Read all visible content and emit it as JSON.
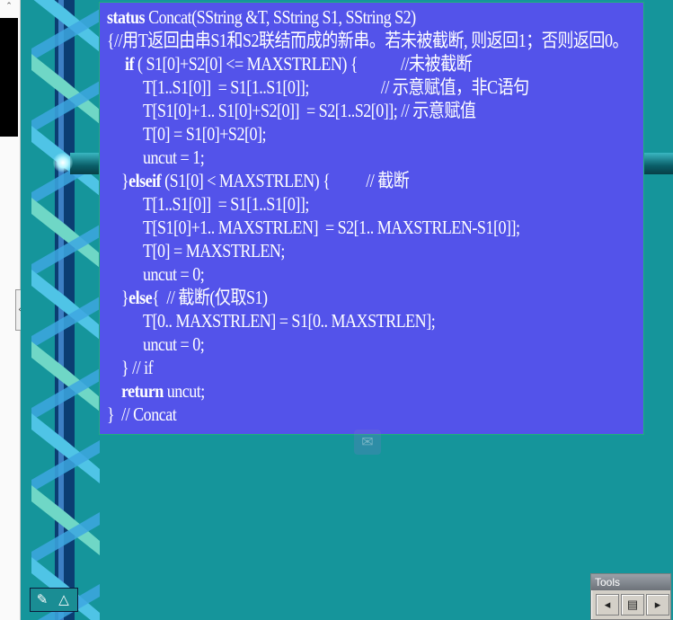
{
  "left_panel": {
    "scroll_up_label": "⌃",
    "collapse_label": "‹"
  },
  "code": {
    "lines": [
      {
        "indent": 8,
        "parts": [
          {
            "t": "status",
            "b": true
          },
          {
            "t": " Concat(SString &T, SString S1, SString S2)"
          }
        ]
      },
      {
        "indent": 8,
        "parts": [
          {
            "t": "{//用T返回由串S1和S2联结而成的新串。若未被截断, 则返回1；否则返回0。"
          }
        ]
      },
      {
        "indent": 28,
        "parts": [
          {
            "t": "if",
            "b": true
          },
          {
            "t": " ( S1[0]+S2[0] <= MAXSTRLEN) {            //未被截断"
          }
        ]
      },
      {
        "indent": 48,
        "parts": [
          {
            "t": "T[1..S1[0]]  = S1[1..S1[0]];                    // 示意赋值，非C语句"
          }
        ]
      },
      {
        "indent": 48,
        "parts": [
          {
            "t": "T[S1[0]+1.. S1[0]+S2[0]]  = S2[1..S2[0]]; // 示意赋值"
          }
        ]
      },
      {
        "indent": 48,
        "parts": [
          {
            "t": "T[0] = S1[0]+S2[0];"
          }
        ]
      },
      {
        "indent": 48,
        "parts": [
          {
            "t": "uncut = 1;"
          }
        ]
      },
      {
        "indent": 24,
        "parts": [
          {
            "t": "}"
          },
          {
            "t": "elseif",
            "b": true
          },
          {
            "t": " (S1[0] < MAXSTRLEN) {          // 截断"
          }
        ]
      },
      {
        "indent": 48,
        "parts": [
          {
            "t": "T[1..S1[0]]  = S1[1..S1[0]];"
          }
        ]
      },
      {
        "indent": 48,
        "parts": [
          {
            "t": "T[S1[0]+1.. MAXSTRLEN]  = S2[1.. MAXSTRLEN-S1[0]];"
          }
        ]
      },
      {
        "indent": 48,
        "parts": [
          {
            "t": "T[0] = MAXSTRLEN;"
          }
        ]
      },
      {
        "indent": 48,
        "parts": [
          {
            "t": "uncut = 0;"
          }
        ]
      },
      {
        "indent": 24,
        "parts": [
          {
            "t": "}"
          },
          {
            "t": "else",
            "b": true
          },
          {
            "t": "{  // 截断(仅取S1)"
          }
        ]
      },
      {
        "indent": 48,
        "parts": [
          {
            "t": "T[0.. MAXSTRLEN] = S1[0.. MAXSTRLEN];"
          }
        ]
      },
      {
        "indent": 48,
        "parts": [
          {
            "t": "uncut = 0;"
          }
        ]
      },
      {
        "indent": 24,
        "parts": [
          {
            "t": "} // if"
          }
        ]
      },
      {
        "indent": 24,
        "parts": [
          {
            "t": "return",
            "b": true
          },
          {
            "t": " uncut;"
          }
        ]
      },
      {
        "indent": 8,
        "parts": [
          {
            "t": "}  // Concat"
          }
        ]
      }
    ]
  },
  "nav": {
    "pen_icon": "✎",
    "shape_icon": "△"
  },
  "tools": {
    "title": "Tools",
    "buttons": [
      {
        "name": "prev-slide-button",
        "icon": "◂"
      },
      {
        "name": "slide-menu-button",
        "icon": "▤"
      },
      {
        "name": "next-slide-button",
        "icon": "▸"
      }
    ]
  },
  "colors": {
    "background": "#15959b",
    "code_box": "#5353ea",
    "code_text": "#ffffff"
  }
}
